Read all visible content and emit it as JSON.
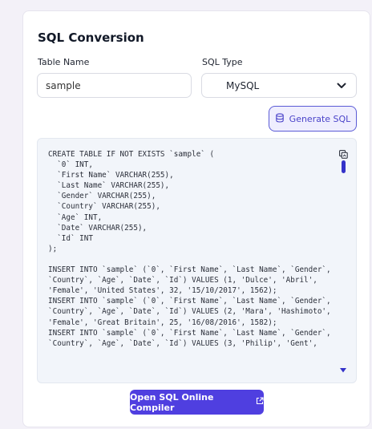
{
  "header": {
    "title": "SQL Conversion"
  },
  "form": {
    "table_name_label": "Table Name",
    "table_name_value": "sample",
    "sql_type_label": "SQL Type",
    "sql_type_value": "MySQL"
  },
  "actions": {
    "generate_label": "Generate SQL",
    "open_compiler_label": "Open SQL Online Compiler"
  },
  "output": {
    "code": "CREATE TABLE IF NOT EXISTS `sample` (\n  `0` INT,\n  `First Name` VARCHAR(255),\n  `Last Name` VARCHAR(255),\n  `Gender` VARCHAR(255),\n  `Country` VARCHAR(255),\n  `Age` INT,\n  `Date` VARCHAR(255),\n  `Id` INT\n);\n\nINSERT INTO `sample` (`0`, `First Name`, `Last Name`, `Gender`,\n`Country`, `Age`, `Date`, `Id`) VALUES (1, 'Dulce', 'Abril',\n'Female', 'United States', 32, '15/10/2017', 1562);\nINSERT INTO `sample` (`0`, `First Name`, `Last Name`, `Gender`,\n`Country`, `Age`, `Date`, `Id`) VALUES (2, 'Mara', 'Hashimoto',\n'Female', 'Great Britain', 25, '16/08/2016', 1582);\nINSERT INTO `sample` (`0`, `First Name`, `Last Name`, `Gender`,\n`Country`, `Age`, `Date`, `Id`) VALUES (3, 'Philip', 'Gent',"
  },
  "icons": {
    "copy": "copy-icon",
    "database": "database-icon",
    "external_link": "external-link-icon",
    "chevron": "chevron-down-icon"
  },
  "colors": {
    "accent": "#4f3fe0",
    "code_bg": "#f2f5fa",
    "page_bg": "#f3f1f8"
  }
}
